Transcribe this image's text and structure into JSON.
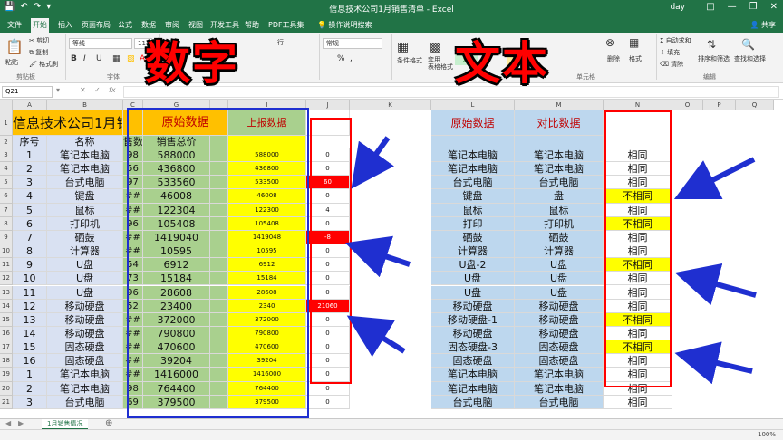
{
  "window": {
    "title": "信息技术公司1月销售清单 - Excel",
    "user": "day",
    "share": "共享",
    "tell_me": "操作说明搜索"
  },
  "tabs": [
    "文件",
    "开始",
    "插入",
    "页面布局",
    "公式",
    "数据",
    "审阅",
    "视图",
    "开发工具",
    "帮助",
    "PDF工具集"
  ],
  "ribbon": {
    "cut": "剪切",
    "copy": "复制",
    "format_painter": "格式刷",
    "paste": "粘贴",
    "clipboard": "剪贴板",
    "font_name": "等线",
    "font_size": "11",
    "font_group": "字体",
    "bold": "B",
    "italic": "I",
    "underline": "U",
    "wrap_text": "行",
    "number_format": "常规",
    "percent": "%",
    "comma": ",",
    "cond_format": "条件格式",
    "table_format": "套用\n表格格式",
    "style_good": "好",
    "style_neutral": "适中",
    "delete": "删除",
    "format": "格式",
    "cells_group": "单元格",
    "autosum": "自动求和",
    "fill": "填充",
    "clear": "清除",
    "sort_filter": "排序和筛选",
    "find_select": "查找和选择",
    "edit_group": "编辑"
  },
  "formula_bar": {
    "name_box": "Q21",
    "fx": "fx"
  },
  "columns": [
    "A",
    "B",
    "C",
    "G",
    "I",
    "J",
    "K",
    "L",
    "M",
    "N",
    "O",
    "P",
    "Q"
  ],
  "sheet_title": "信息技术公司1月销",
  "headers": {
    "original_data": "原始数据",
    "reported_data": "上报数据",
    "text_original": "原始数据",
    "text_compare": "对比数据",
    "seq": "序号",
    "name": "名称",
    "qty": "售数",
    "total": "销售总价"
  },
  "rows": [
    {
      "seq": "1",
      "name": "笔记本电脑",
      "qty": "98",
      "orig": "588000",
      "rep": "588000",
      "diff": "0",
      "diff_red": false,
      "l": "笔记本电脑",
      "m": "笔记本电脑",
      "n": "相同",
      "n_yellow": false
    },
    {
      "seq": "2",
      "name": "笔记本电脑",
      "qty": "56",
      "orig": "436800",
      "rep": "436800",
      "diff": "0",
      "diff_red": false,
      "l": "笔记本电脑",
      "m": "笔记本电脑",
      "n": "相同",
      "n_yellow": false
    },
    {
      "seq": "3",
      "name": "台式电脑",
      "qty": "97",
      "orig": "533560",
      "rep": "533500",
      "diff": "60",
      "diff_red": true,
      "l": "台式电脑",
      "m": "台式电脑",
      "n": "相同",
      "n_yellow": false
    },
    {
      "seq": "4",
      "name": "键盘",
      "qty": "##",
      "orig": "46008",
      "rep": "46008",
      "diff": "0",
      "diff_red": false,
      "l": "键盘",
      "m": "盘",
      "n": "不相同",
      "n_yellow": true
    },
    {
      "seq": "5",
      "name": "鼠标",
      "qty": "##",
      "orig": "122304",
      "rep": "122300",
      "diff": "4",
      "diff_red": false,
      "l": "鼠标",
      "m": "鼠标",
      "n": "相同",
      "n_yellow": false
    },
    {
      "seq": "6",
      "name": "打印机",
      "qty": "96",
      "orig": "105408",
      "rep": "105408",
      "diff": "0",
      "diff_red": false,
      "l": "打印",
      "m": "打印机",
      "n": "不相同",
      "n_yellow": true
    },
    {
      "seq": "7",
      "name": "硒鼓",
      "qty": "##",
      "orig": "1419040",
      "rep": "1419048",
      "diff": "-8",
      "diff_red": true,
      "l": "硒鼓",
      "m": "硒鼓",
      "n": "相同",
      "n_yellow": false
    },
    {
      "seq": "8",
      "name": "计算器",
      "qty": "##",
      "orig": "10595",
      "rep": "10595",
      "diff": "0",
      "diff_red": false,
      "l": "计算器",
      "m": "计算器",
      "n": "相同",
      "n_yellow": false
    },
    {
      "seq": "9",
      "name": "U盘",
      "qty": "54",
      "orig": "6912",
      "rep": "6912",
      "diff": "0",
      "diff_red": false,
      "l": "U盘-2",
      "m": "U盘",
      "n": "不相同",
      "n_yellow": true
    },
    {
      "seq": "10",
      "name": "U盘",
      "qty": "73",
      "orig": "15184",
      "rep": "15184",
      "diff": "0",
      "diff_red": false,
      "l": "U盘",
      "m": "U盘",
      "n": "相同",
      "n_yellow": false
    },
    {
      "seq": "11",
      "name": "U盘",
      "qty": "96",
      "orig": "28608",
      "rep": "28608",
      "diff": "0",
      "diff_red": false,
      "l": "U盘",
      "m": "U盘",
      "n": "相同",
      "n_yellow": false
    },
    {
      "seq": "12",
      "name": "移动硬盘",
      "qty": "52",
      "orig": "23400",
      "rep": "2340",
      "diff": "21060",
      "diff_red": true,
      "l": "移动硬盘",
      "m": "移动硬盘",
      "n": "相同",
      "n_yellow": false
    },
    {
      "seq": "13",
      "name": "移动硬盘",
      "qty": "##",
      "orig": "372000",
      "rep": "372000",
      "diff": "0",
      "diff_red": false,
      "l": "移动硬盘-1",
      "m": "移动硬盘",
      "n": "不相同",
      "n_yellow": true
    },
    {
      "seq": "14",
      "name": "移动硬盘",
      "qty": "##",
      "orig": "790800",
      "rep": "790800",
      "diff": "0",
      "diff_red": false,
      "l": "移动硬盘",
      "m": "移动硬盘",
      "n": "相同",
      "n_yellow": false
    },
    {
      "seq": "15",
      "name": "固态硬盘",
      "qty": "##",
      "orig": "470600",
      "rep": "470600",
      "diff": "0",
      "diff_red": false,
      "l": "固态硬盘-3",
      "m": "固态硬盘",
      "n": "不相同",
      "n_yellow": true
    },
    {
      "seq": "16",
      "name": "固态硬盘",
      "qty": "##",
      "orig": "39204",
      "rep": "39204",
      "diff": "0",
      "diff_red": false,
      "l": "固态硬盘",
      "m": "固态硬盘",
      "n": "相同",
      "n_yellow": false
    },
    {
      "seq": "1",
      "name": "笔记本电脑",
      "qty": "##",
      "orig": "1416000",
      "rep": "1416000",
      "diff": "0",
      "diff_red": false,
      "l": "笔记本电脑",
      "m": "笔记本电脑",
      "n": "相同",
      "n_yellow": false
    },
    {
      "seq": "2",
      "name": "笔记本电脑",
      "qty": "98",
      "orig": "764400",
      "rep": "764400",
      "diff": "0",
      "diff_red": false,
      "l": "笔记本电脑",
      "m": "笔记本电脑",
      "n": "相同",
      "n_yellow": false
    },
    {
      "seq": "3",
      "name": "台式电脑",
      "qty": "69",
      "orig": "379500",
      "rep": "379500",
      "diff": "0",
      "diff_red": false,
      "l": "台式电脑",
      "m": "台式电脑",
      "n": "相同",
      "n_yellow": false
    }
  ],
  "overlay": {
    "left_title": "数字",
    "right_title": "文本"
  },
  "sheet_tab": "1月销售情况",
  "zoom": "100%",
  "colors": {
    "excel_green": "#217346",
    "highlight_red": "#ff0000",
    "highlight_blue": "#1f2fd0",
    "yellow": "#ffff00"
  }
}
